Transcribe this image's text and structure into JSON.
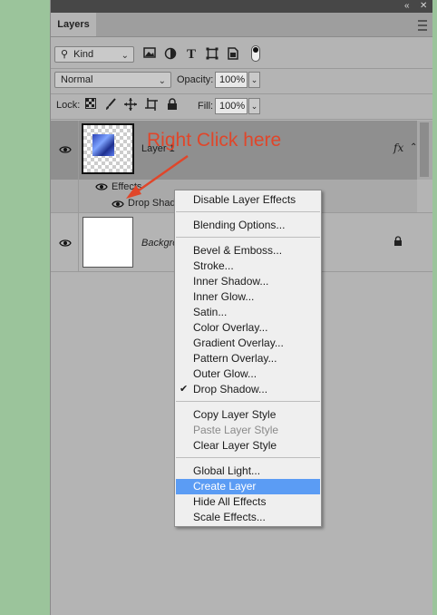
{
  "panel": {
    "title": "Layers",
    "window_controls": {
      "collapse": "«",
      "close": "✕"
    }
  },
  "filter": {
    "kind_label": "Kind",
    "icons": [
      "image-filter-icon",
      "adjustment-filter-icon",
      "type-filter-icon",
      "shape-filter-icon",
      "smart-object-filter-icon",
      "filter-toggle"
    ]
  },
  "blend": {
    "mode": "Normal",
    "opacity_label": "Opacity:",
    "opacity_value": "100%"
  },
  "lock": {
    "label": "Lock:",
    "fill_label": "Fill:",
    "fill_value": "100%"
  },
  "layers": [
    {
      "name": "Layer 1",
      "fx": "fx",
      "effects_label": "Effects",
      "effect_name": "Drop Shadow"
    },
    {
      "name": "Background"
    }
  ],
  "annotation": {
    "text": "Right Click here",
    "color": "#e0462a"
  },
  "context_menu": {
    "groups": [
      [
        {
          "label": "Disable Layer Effects"
        }
      ],
      [
        {
          "label": "Blending Options..."
        }
      ],
      [
        {
          "label": "Bevel & Emboss..."
        },
        {
          "label": "Stroke..."
        },
        {
          "label": "Inner Shadow..."
        },
        {
          "label": "Inner Glow..."
        },
        {
          "label": "Satin..."
        },
        {
          "label": "Color Overlay..."
        },
        {
          "label": "Gradient Overlay..."
        },
        {
          "label": "Pattern Overlay..."
        },
        {
          "label": "Outer Glow..."
        },
        {
          "label": "Drop Shadow...",
          "checked": true
        }
      ],
      [
        {
          "label": "Copy Layer Style"
        },
        {
          "label": "Paste Layer Style",
          "disabled": true
        },
        {
          "label": "Clear Layer Style"
        }
      ],
      [
        {
          "label": "Global Light..."
        },
        {
          "label": "Create Layer",
          "highlighted": true
        },
        {
          "label": "Hide All Effects"
        },
        {
          "label": "Scale Effects..."
        }
      ]
    ]
  },
  "colors": {
    "highlight": "#5b9cf4",
    "desktop": "#9bc49b",
    "panel": "#b4b4b4",
    "selected_row": "#8f8f8f"
  }
}
